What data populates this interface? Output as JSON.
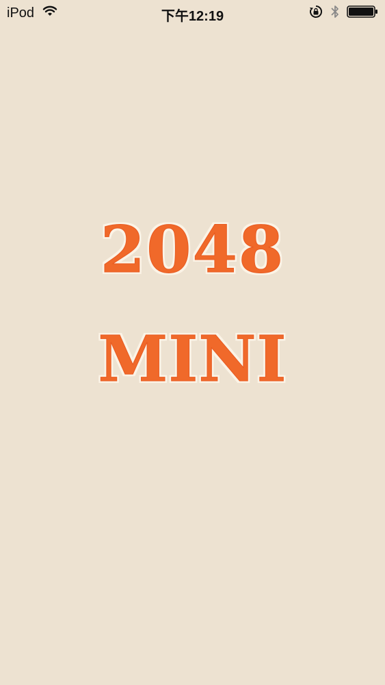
{
  "status_bar": {
    "carrier": "iPod",
    "time": "下午12:19",
    "icons": [
      "wifi-icon",
      "rotation-lock-icon",
      "bluetooth-icon",
      "battery-icon"
    ]
  },
  "splash": {
    "title_line1": "2048",
    "title_line2": "MINI"
  },
  "colors": {
    "background": "#ede2d1",
    "title": "#f0692a",
    "title_outline": "#fbf3e6"
  }
}
